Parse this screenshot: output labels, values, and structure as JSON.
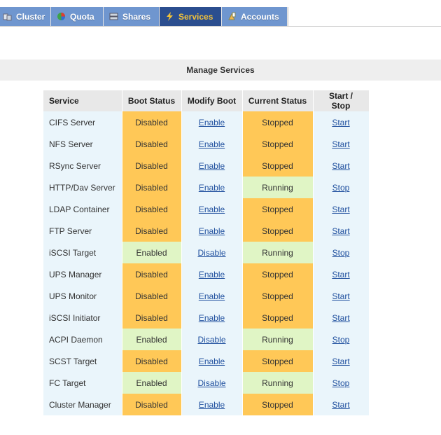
{
  "tabs": [
    {
      "label": "Cluster",
      "icon": "cluster-icon",
      "active": false
    },
    {
      "label": "Quota",
      "icon": "quota-icon",
      "active": false
    },
    {
      "label": "Shares",
      "icon": "shares-icon",
      "active": false
    },
    {
      "label": "Services",
      "icon": "lightning-icon",
      "active": true
    },
    {
      "label": "Accounts",
      "icon": "accounts-icon",
      "active": false
    }
  ],
  "section_title": "Manage Services",
  "columns": [
    "Service",
    "Boot Status",
    "Modify Boot",
    "Current Status",
    "Start / Stop"
  ],
  "colors": {
    "tab_bg": "#6f96cf",
    "tab_active_bg": "#2b4e8f",
    "tab_active_text": "#f2c23a",
    "disabled_stopped": "#ffc857",
    "enabled_running": "#e0f5c5",
    "row_bg": "#eaf5fb",
    "link": "#1f4f9e"
  },
  "services": [
    {
      "name": "CIFS Server",
      "boot": "Disabled",
      "modify": "Enable",
      "current": "Stopped",
      "action": "Start"
    },
    {
      "name": "NFS Server",
      "boot": "Disabled",
      "modify": "Enable",
      "current": "Stopped",
      "action": "Start"
    },
    {
      "name": "RSync Server",
      "boot": "Disabled",
      "modify": "Enable",
      "current": "Stopped",
      "action": "Start"
    },
    {
      "name": "HTTP/Dav Server",
      "boot": "Disabled",
      "modify": "Enable",
      "current": "Running",
      "action": "Stop"
    },
    {
      "name": "LDAP Container",
      "boot": "Disabled",
      "modify": "Enable",
      "current": "Stopped",
      "action": "Start"
    },
    {
      "name": "FTP Server",
      "boot": "Disabled",
      "modify": "Enable",
      "current": "Stopped",
      "action": "Start"
    },
    {
      "name": "iSCSI Target",
      "boot": "Enabled",
      "modify": "Disable",
      "current": "Running",
      "action": "Stop"
    },
    {
      "name": "UPS Manager",
      "boot": "Disabled",
      "modify": "Enable",
      "current": "Stopped",
      "action": "Start"
    },
    {
      "name": "UPS Monitor",
      "boot": "Disabled",
      "modify": "Enable",
      "current": "Stopped",
      "action": "Start"
    },
    {
      "name": "iSCSI Initiator",
      "boot": "Disabled",
      "modify": "Enable",
      "current": "Stopped",
      "action": "Start"
    },
    {
      "name": "ACPI Daemon",
      "boot": "Enabled",
      "modify": "Disable",
      "current": "Running",
      "action": "Stop"
    },
    {
      "name": "SCST Target",
      "boot": "Disabled",
      "modify": "Enable",
      "current": "Stopped",
      "action": "Start"
    },
    {
      "name": "FC Target",
      "boot": "Enabled",
      "modify": "Disable",
      "current": "Running",
      "action": "Stop"
    },
    {
      "name": "Cluster Manager",
      "boot": "Disabled",
      "modify": "Enable",
      "current": "Stopped",
      "action": "Start"
    }
  ]
}
